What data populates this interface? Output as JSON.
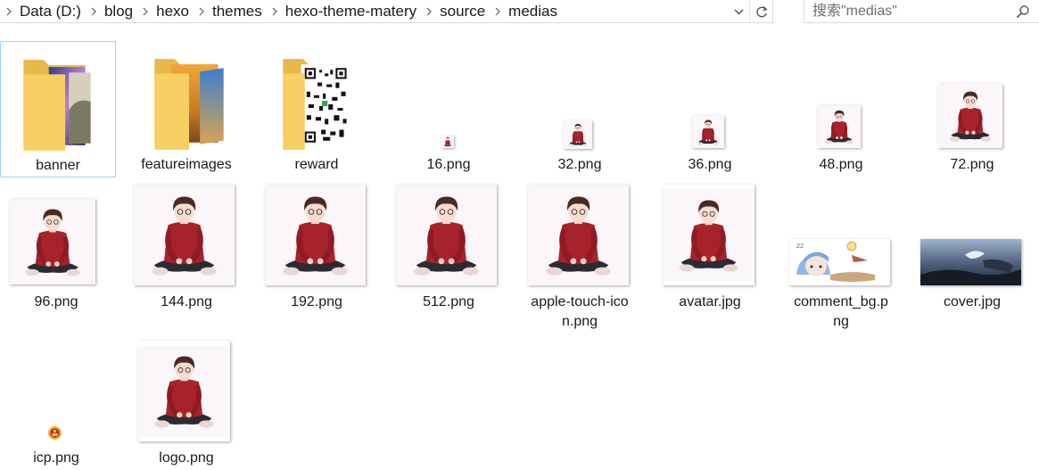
{
  "breadcrumb": {
    "items": [
      "Data (D:)",
      "blog",
      "hexo",
      "themes",
      "hexo-theme-matery",
      "source",
      "medias"
    ]
  },
  "search": {
    "placeholder": "搜索\"medias\""
  },
  "files": {
    "banner": "banner",
    "featureimages": "featureimages",
    "reward": "reward",
    "p16": "16.png",
    "p32": "32.png",
    "p36": "36.png",
    "p48": "48.png",
    "p72": "72.png",
    "p96": "96.png",
    "p144": "144.png",
    "p192": "192.png",
    "p512": "512.png",
    "apple_line1": "apple-touch-ico",
    "apple_line2": "n.png",
    "avatar": "avatar.jpg",
    "comment_line1": "comment_bg.p",
    "comment_line2": "ng",
    "cover": "cover.jpg",
    "icp": "icp.png",
    "logo": "logo.png"
  },
  "icons": {
    "folder": "folder-icon",
    "refresh": "refresh-icon",
    "search": "search-icon",
    "dropdown": "chevron-down-icon",
    "crumb_sep": "chevron-right-icon"
  },
  "colors": {
    "selection_border": "#99d1ff",
    "folder_yellow": "#f5c95c",
    "sweater_red": "#a8222c"
  }
}
